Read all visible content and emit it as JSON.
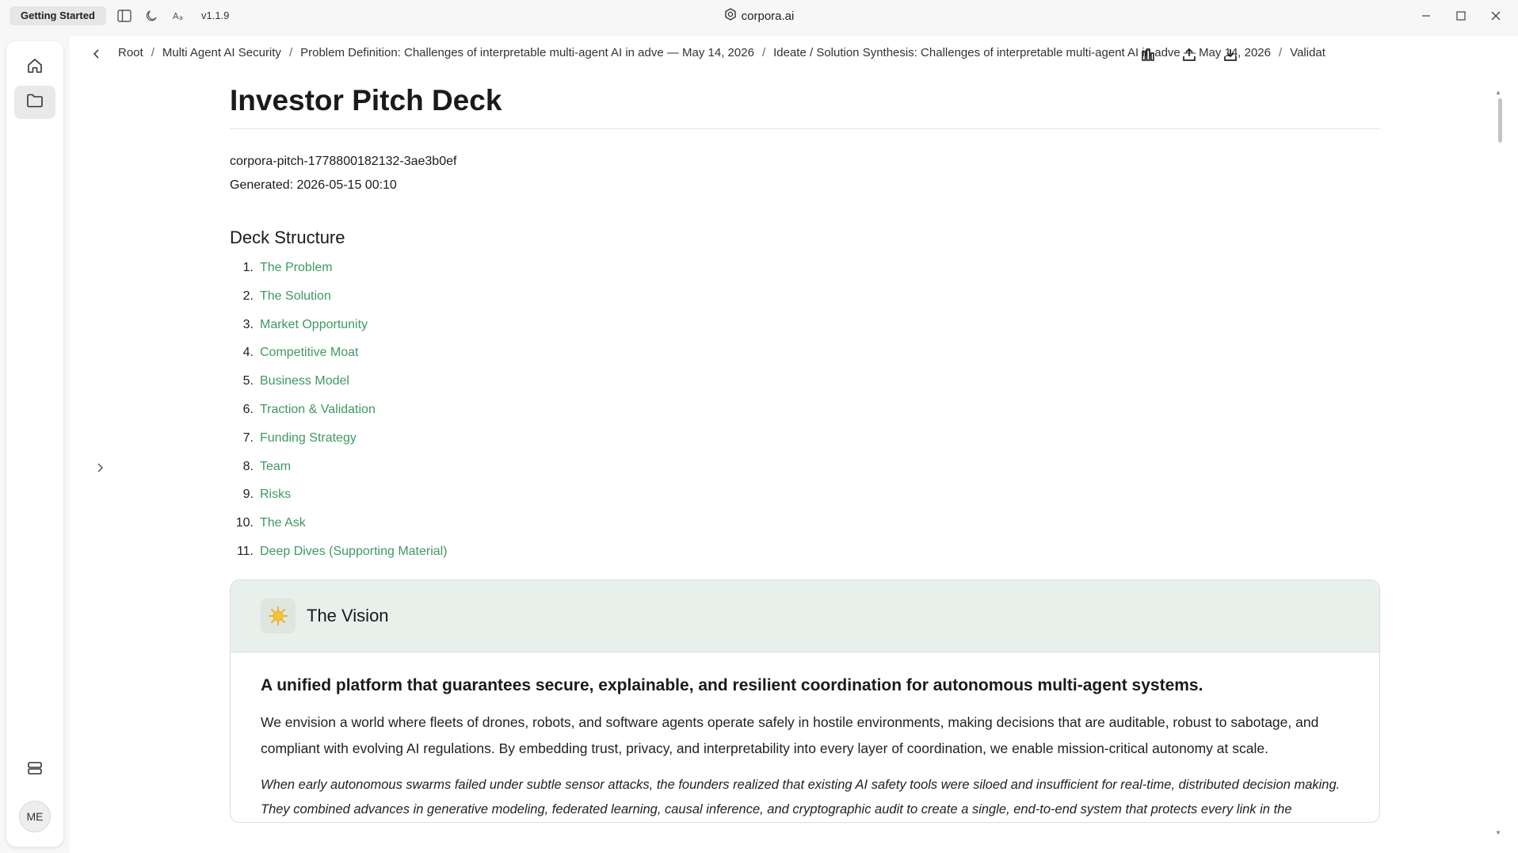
{
  "titlebar": {
    "getting_started": "Getting Started",
    "version": "v1.1.9",
    "app_name": "corpora.ai"
  },
  "rail": {
    "avatar_initials": "ME"
  },
  "breadcrumb": {
    "items": [
      "Root",
      "Multi Agent AI Security",
      "Problem Definition: Challenges of interpretable multi-agent AI in adve — May 14, 2026",
      "Ideate / Solution Synthesis: Challenges of interpretable multi-agent AI in adve — May 14, 2026",
      "Validat"
    ]
  },
  "doc": {
    "title": "Investor Pitch Deck",
    "id_line": "corpora-pitch-1778800182132-3ae3b0ef",
    "generated_line": "Generated: 2026-05-15 00:10",
    "structure_heading": "Deck Structure",
    "toc": [
      {
        "num": "1.",
        "label": "The Problem"
      },
      {
        "num": "2.",
        "label": "The Solution"
      },
      {
        "num": "3.",
        "label": "Market Opportunity"
      },
      {
        "num": "4.",
        "label": "Competitive Moat"
      },
      {
        "num": "5.",
        "label": "Business Model"
      },
      {
        "num": "6.",
        "label": "Traction & Validation"
      },
      {
        "num": "7.",
        "label": "Funding Strategy"
      },
      {
        "num": "8.",
        "label": "Team"
      },
      {
        "num": "9.",
        "label": "Risks"
      },
      {
        "num": "10.",
        "label": "The Ask"
      },
      {
        "num": "11.",
        "label": "Deep Dives (Supporting Material)"
      }
    ],
    "vision": {
      "icon": "sun-emoji-icon",
      "title": "The Vision",
      "lead": "A unified platform that guarantees secure, explainable, and resilient coordination for autonomous multi-agent systems.",
      "paragraph": "We envision a world where fleets of drones, robots, and software agents operate safely in hostile environments, making decisions that are auditable, robust to sabotage, and compliant with evolving AI regulations. By embedding trust, privacy, and interpretability into every layer of coordination, we enable mission-critical autonomy at scale.",
      "story": "When early autonomous swarms failed under subtle sensor attacks, the founders realized that existing AI safety tools were siloed and insufficient for real-time, distributed decision making. They combined advances in generative modeling, federated learning, causal inference, and cryptographic audit to create a single, end-to-end system that protects every link in the"
    }
  },
  "colors": {
    "link": "#3d9a5f",
    "card_header": "#e7f0eb"
  }
}
